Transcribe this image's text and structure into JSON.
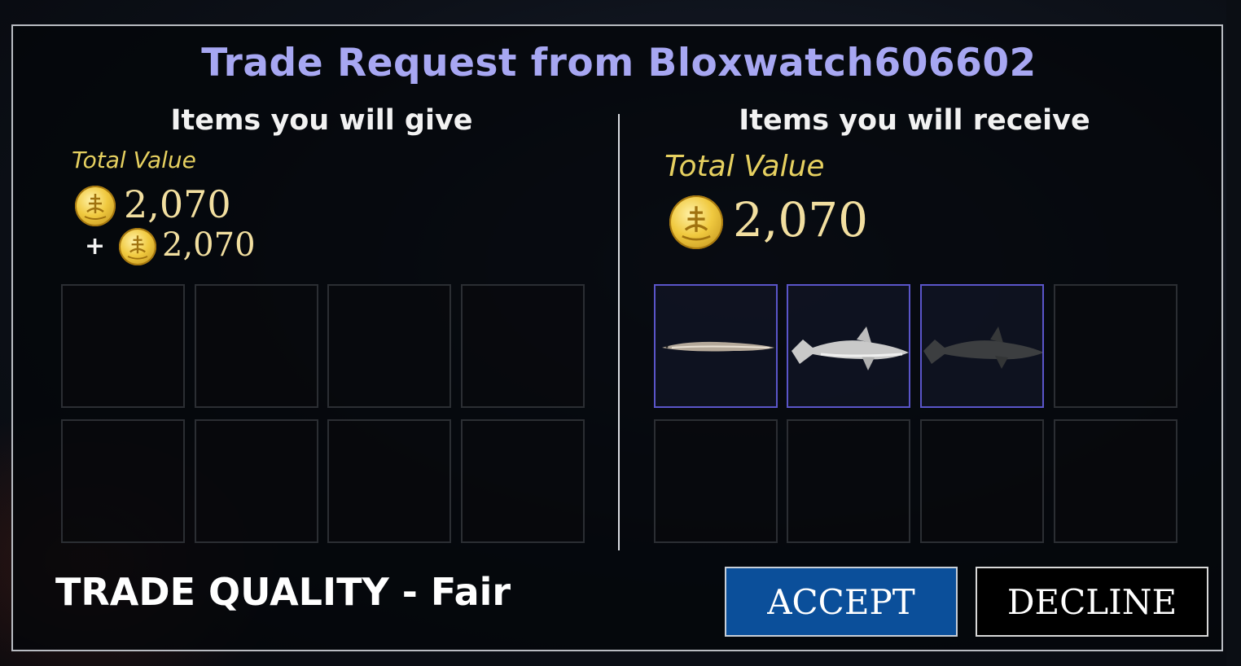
{
  "title": "Trade Request from Bloxwatch606602",
  "give": {
    "heading": "Items you will give",
    "total_label": "Total Value",
    "total_value": "2,070",
    "plus_sign": "+",
    "extra_value": "2,070",
    "slots": [
      "",
      "",
      "",
      "",
      "",
      "",
      "",
      ""
    ]
  },
  "receive": {
    "heading": "Items you will receive",
    "total_label": "Total Value",
    "total_value": "2,070",
    "items": [
      {
        "icon": "small-fish-icon"
      },
      {
        "icon": "great-white-shark-icon"
      },
      {
        "icon": "dark-shark-icon"
      }
    ],
    "empty_slots": 5
  },
  "quality": "TRADE QUALITY - Fair",
  "buttons": {
    "accept": "ACCEPT",
    "decline": "DECLINE"
  },
  "colors": {
    "title": "#a7a7f2",
    "total_label": "#e6d060",
    "accept_bg": "#0b4f9a",
    "filled_slot_border": "#5a55c9"
  }
}
